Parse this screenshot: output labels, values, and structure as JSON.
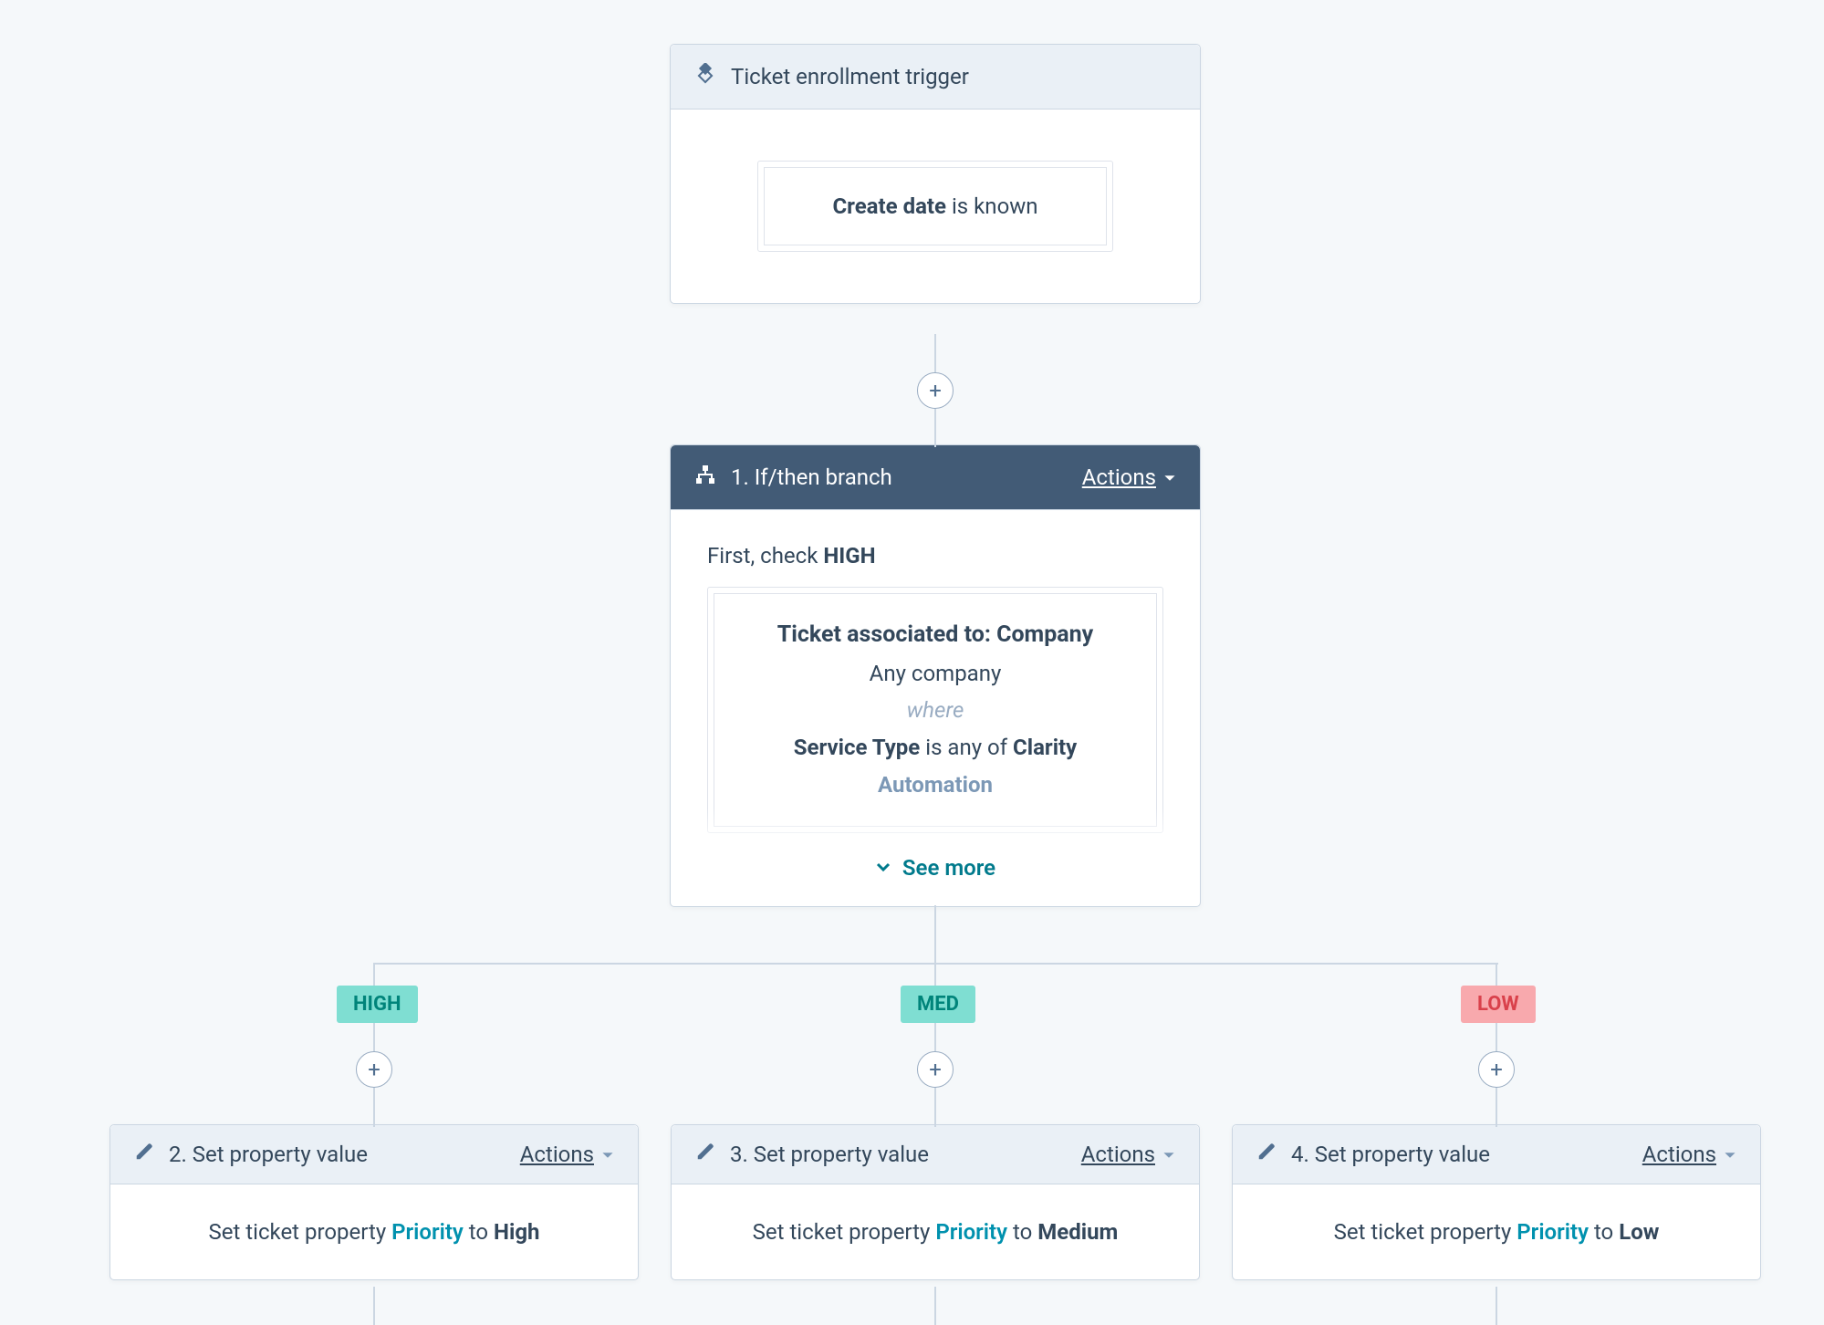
{
  "trigger": {
    "title": "Ticket enrollment trigger",
    "condition_property": "Create date",
    "condition_operator": " is known"
  },
  "branch": {
    "step_label": "1. If/then branch",
    "actions_label": "Actions",
    "first_check_prefix": "First, check ",
    "first_check_value": "HIGH",
    "assoc_label": "Ticket associated to: Company",
    "assoc_sub": "Any company",
    "where_label": "where",
    "cond_prop": "Service Type",
    "cond_op": " is any of ",
    "cond_val": "Clarity",
    "cond_extra": "Automation",
    "see_more": "See more"
  },
  "labels": {
    "high": "HIGH",
    "med": "MED",
    "low": "LOW"
  },
  "actions": {
    "a2": {
      "title": "2. Set property value",
      "actions_label": "Actions",
      "prefix": "Set ticket property ",
      "prop": "Priority",
      "mid": " to ",
      "value": "High"
    },
    "a3": {
      "title": "3. Set property value",
      "actions_label": "Actions",
      "prefix": "Set ticket property ",
      "prop": "Priority",
      "mid": " to ",
      "value": "Medium"
    },
    "a4": {
      "title": "4. Set property value",
      "actions_label": "Actions",
      "prefix": "Set ticket property ",
      "prop": "Priority",
      "mid": " to ",
      "value": "Low"
    }
  }
}
